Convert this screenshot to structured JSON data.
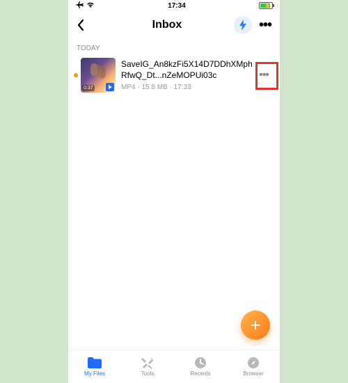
{
  "status": {
    "time": "17:34"
  },
  "nav": {
    "title": "Inbox"
  },
  "section": {
    "today": "TODAY"
  },
  "file": {
    "name": "SaveIG_An8kzFi5X14D7DDhXMphRfwQ_Dt...nZeMOPUi03c",
    "type": "MP4",
    "size": "15.8 MB",
    "time": "17:33",
    "duration": "0:37"
  },
  "tabs": {
    "myfiles": "My Files",
    "tools": "Tools",
    "recents": "Recents",
    "browser": "Browser"
  }
}
